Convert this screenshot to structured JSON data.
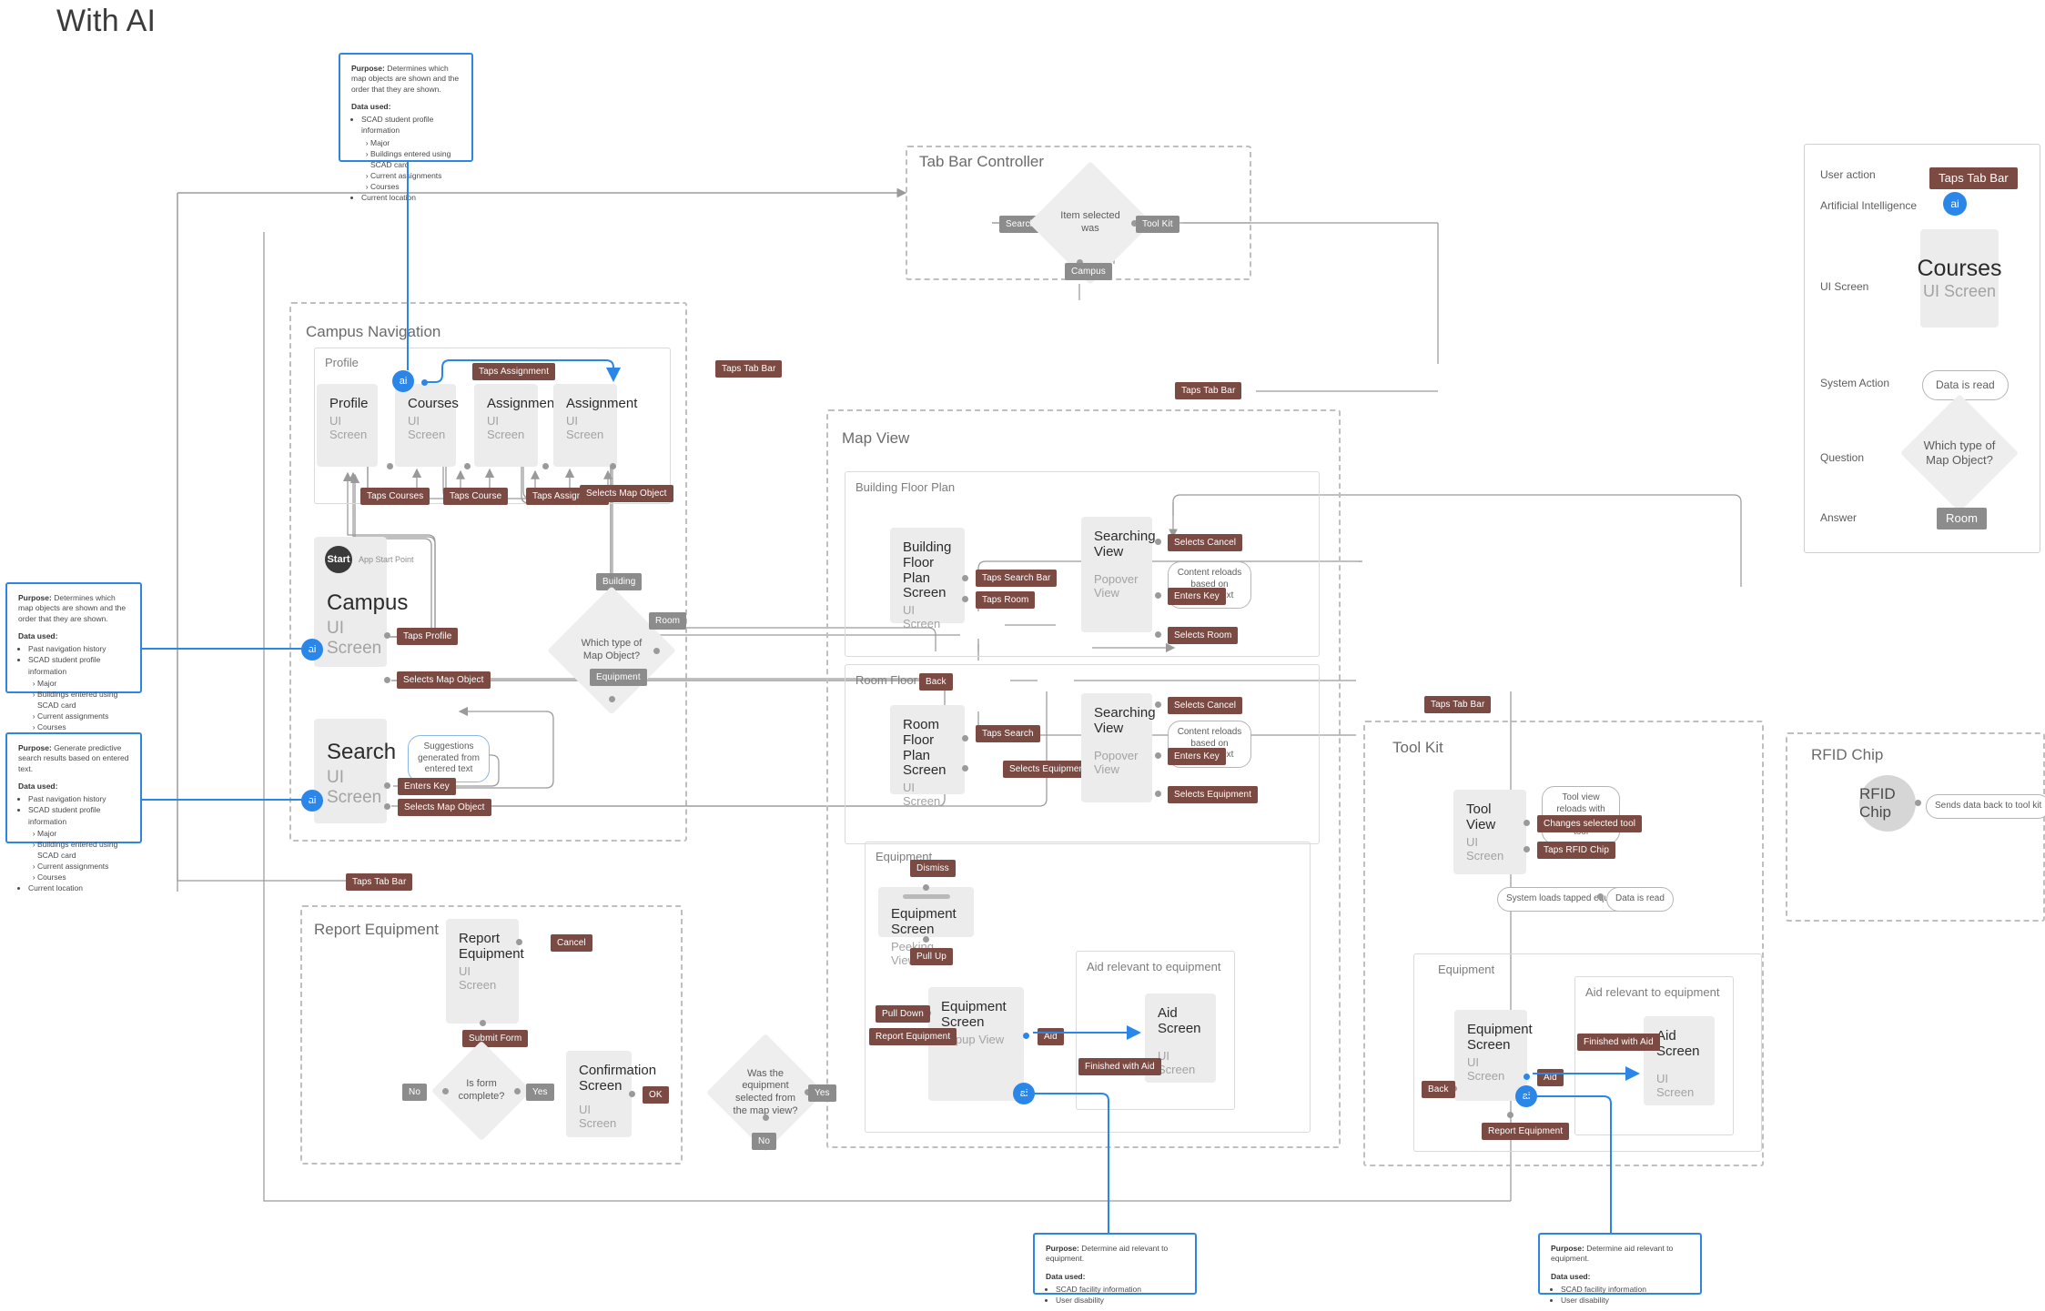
{
  "page": {
    "title": "With AI"
  },
  "legend": {
    "rows": [
      {
        "label": "User action",
        "sample": "Taps Tab Bar"
      },
      {
        "label": "Artificial Intelligence",
        "sample": "ai"
      },
      {
        "label": "UI Screen",
        "sample_title": "Courses",
        "sample_sub": "UI Screen"
      },
      {
        "label": "System Action",
        "sample": "Data is read"
      },
      {
        "label": "Question",
        "sample": "Which type of Map Object?"
      },
      {
        "label": "Answer",
        "sample": "Room"
      }
    ]
  },
  "groups": {
    "tab_bar_controller": "Tab Bar Controller",
    "campus_navigation": "Campus Navigation",
    "profile": "Profile",
    "map_view": "Map View",
    "building_floor_plan": "Building Floor Plan",
    "room_floor_plan": "Room Floor Plan",
    "equipment": "Equipment",
    "aid_relevant": "Aid relevant to equipment",
    "report_equipment": "Report Equipment",
    "tool_kit": "Tool Kit",
    "rfid_chip": "RFID Chip",
    "tk_equipment": "Equipment",
    "tk_aid_relevant": "Aid relevant to equipment"
  },
  "screens": {
    "profile": {
      "title": "Profile",
      "sub": "UI Screen"
    },
    "courses": {
      "title": "Courses",
      "sub": "UI Screen"
    },
    "assignments": {
      "title": "Assignments",
      "sub": "UI Screen"
    },
    "assignment": {
      "title": "Assignment",
      "sub": "UI Screen"
    },
    "campus": {
      "title": "Campus",
      "sub": "UI Screen",
      "start_badge": "Start",
      "start_text": "App Start Point"
    },
    "search": {
      "title": "Search",
      "sub": "UI Screen"
    },
    "building_floor": {
      "title": "Building Floor Plan Screen",
      "sub": "UI Screen"
    },
    "bf_searching": {
      "title": "Searching View",
      "sub": "Popover View"
    },
    "room_floor": {
      "title": "Room Floor Plan Screen",
      "sub": "UI Screen"
    },
    "rf_searching": {
      "title": "Searching View",
      "sub": "Popover View"
    },
    "equip_peek": {
      "title": "Equipment Screen",
      "sub": "Peeking View"
    },
    "equip_popup": {
      "title": "Equipment Screen",
      "sub": "Popup View"
    },
    "aid": {
      "title": "Aid Screen",
      "sub": "UI Screen"
    },
    "report_equip": {
      "title": "Report Equipment",
      "sub": "UI Screen"
    },
    "confirmation": {
      "title": "Confirmation Screen",
      "sub": "UI Screen"
    },
    "tool_view": {
      "title": "Tool View",
      "sub": "UI Screen"
    },
    "tk_equipment": {
      "title": "Equipment Screen",
      "sub": "UI Screen"
    },
    "tk_aid": {
      "title": "Aid Screen",
      "sub": "UI Screen"
    },
    "rfid": {
      "title": "RFID Chip"
    }
  },
  "questions": {
    "item_selected": "Item selected was",
    "map_object": "Which type of Map Object?",
    "form_complete": "Is form complete?",
    "equip_from_map": "Was the equipment selected from the map view?"
  },
  "answers": {
    "search": "Search",
    "tool_kit": "Tool Kit",
    "campus": "Campus",
    "building": "Building",
    "room": "Room",
    "equipment": "Equipment",
    "yes_form": "Yes",
    "no_form": "No",
    "yes_map": "Yes",
    "no_map": "No"
  },
  "actions": {
    "taps_tab_bar": "Taps Tab Bar",
    "taps_assignment_top": "Taps Assignment",
    "taps_courses": "Taps Courses",
    "taps_course": "Taps Course",
    "taps_assignment": "Taps Assignment",
    "selects_map_object_profile": "Selects Map Object",
    "taps_profile": "Taps Profile",
    "selects_map_object_campus": "Selects Map Object",
    "enters_key_search": "Enters Key",
    "selects_map_object_search": "Selects Map Object",
    "taps_search_bar": "Taps Search Bar",
    "taps_room": "Taps Room",
    "selects_cancel_bf": "Selects Cancel",
    "enters_key_bf": "Enters Key",
    "selects_room": "Selects Room",
    "back_rf": "Back",
    "taps_search_rf": "Taps Search",
    "selects_equipment_rf": "Selects Equipment",
    "selects_cancel_rf": "Selects Cancel",
    "enters_key_rf": "Enters Key",
    "selects_equipment_sv": "Selects Equipment",
    "dismiss": "Dismiss",
    "pull_up": "Pull Up",
    "pull_down": "Pull Down",
    "report_equipment": "Report Equipment",
    "aid": "Aid",
    "finished_with_aid": "Finished with Aid",
    "cancel_report": "Cancel",
    "submit_form": "Submit Form",
    "ok_confirm": "OK",
    "changes_selected_tool": "Changes selected tool",
    "taps_rfid_chip": "Taps RFID Chip",
    "tk_back": "Back",
    "tk_report_equipment": "Report Equipment",
    "tk_aid": "Aid",
    "tk_finished_with_aid": "Finished with Aid"
  },
  "system_actions": {
    "suggestions_generated": "Suggestions generated from entered text",
    "content_reloads_bf": "Content reloads based on entered text",
    "content_reloads_rf": "Content reloads based on entered text",
    "tool_view_reloads": "Tool view reloads with newly selected tool",
    "system_loads_tapped": "System loads tapped equipment",
    "data_is_read": "Data is read",
    "sends_data_back": "Sends data back to tool kit"
  },
  "ai_notes": {
    "top": {
      "purpose_label": "Purpose:",
      "purpose": " Determines which map objects are shown and the order that they are shown.",
      "data_label": "Data used:",
      "items": [
        {
          "text": "SCAD student profile information",
          "sub": [
            "Major",
            "Buildings entered using SCAD card",
            "Current assignments",
            "Courses"
          ]
        },
        {
          "text": "Current location",
          "sub": []
        }
      ]
    },
    "left_campus": {
      "purpose_label": "Purpose:",
      "purpose": " Determines which map objects are shown and the order that they are shown.",
      "data_label": "Data used:",
      "items": [
        {
          "text": "Past navigation history",
          "sub": []
        },
        {
          "text": "SCAD student profile information",
          "sub": [
            "Major",
            "Buildings entered using SCAD card",
            "Current assignments",
            "Courses"
          ]
        },
        {
          "text": "Current location",
          "sub": []
        }
      ]
    },
    "left_search": {
      "purpose_label": "Purpose:",
      "purpose": " Generate predictive search results based on entered text.",
      "data_label": "Data used:",
      "items": [
        {
          "text": "Past navigation history",
          "sub": []
        },
        {
          "text": "SCAD student profile information",
          "sub": [
            "Major",
            "Buildings entered using SCAD card",
            "Current assignments",
            "Courses"
          ]
        },
        {
          "text": "Current location",
          "sub": []
        }
      ]
    },
    "bottom_map": {
      "purpose_label": "Purpose:",
      "purpose": " Determine aid relevant to equipment.",
      "data_label": "Data used:",
      "items": [
        {
          "text": "SCAD facility information",
          "sub": []
        },
        {
          "text": "User disability",
          "sub": []
        }
      ]
    },
    "bottom_tool": {
      "purpose_label": "Purpose:",
      "purpose": " Determine aid relevant to equipment.",
      "data_label": "Data used:",
      "items": [
        {
          "text": "SCAD facility information",
          "sub": []
        },
        {
          "text": "User disability",
          "sub": []
        }
      ]
    }
  },
  "ai_label": "ai",
  "colors": {
    "action": "#7a4a43",
    "answer": "#8c8c8c",
    "ai": "#2a86e8",
    "screen_bg": "#ececec",
    "edge": "#9a9a9a"
  }
}
